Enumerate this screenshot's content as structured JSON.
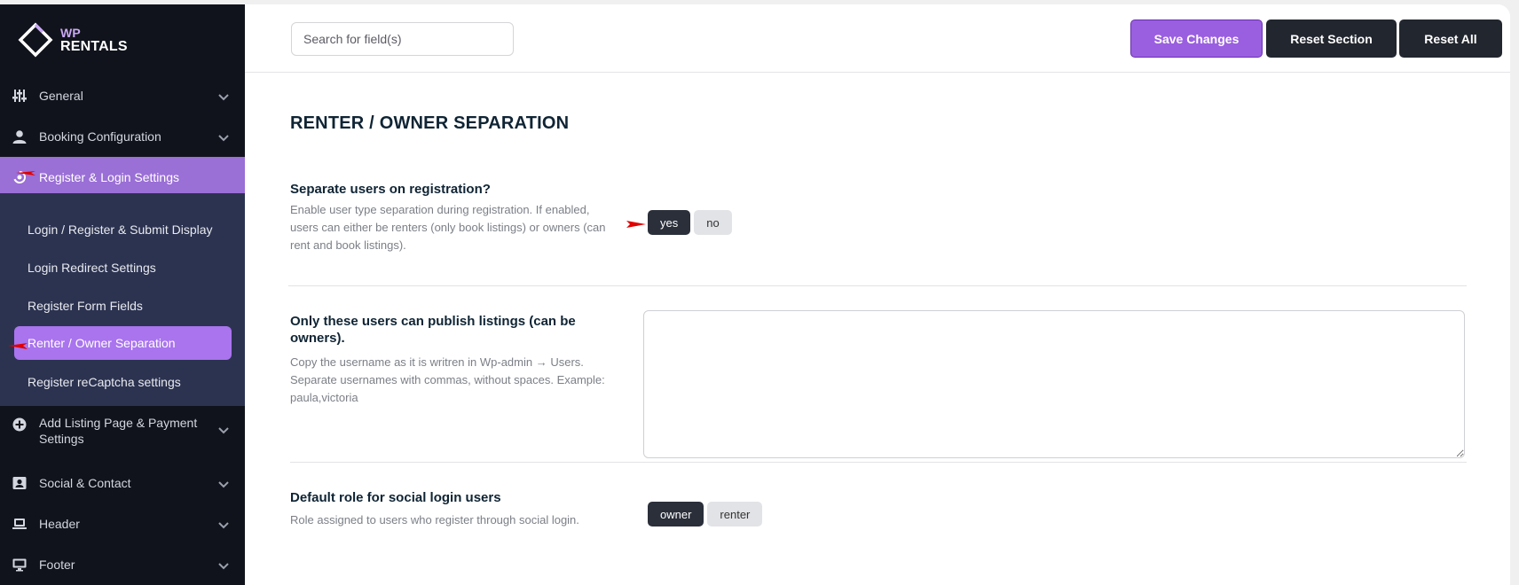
{
  "brand": {
    "line1": "WP",
    "line2": "RENTALS"
  },
  "sidebar": {
    "items": [
      {
        "label": "General",
        "icon": "sliders-icon"
      },
      {
        "label": "Booking Configuration",
        "icon": "user-icon"
      },
      {
        "label": "Register & Login Settings",
        "icon": "login-icon"
      },
      {
        "label": "Add Listing Page & Payment Settings",
        "icon": "plus-circle-icon"
      },
      {
        "label": "Social & Contact",
        "icon": "contact-card-icon"
      },
      {
        "label": "Header",
        "icon": "laptop-icon"
      },
      {
        "label": "Footer",
        "icon": "monitor-icon"
      }
    ],
    "submenu": [
      {
        "label": "Login / Register & Submit Display"
      },
      {
        "label": "Login Redirect Settings"
      },
      {
        "label": "Register Form Fields"
      },
      {
        "label": "Renter / Owner Separation"
      },
      {
        "label": "Register reCaptcha settings"
      }
    ]
  },
  "header": {
    "search_placeholder": "Search for field(s)",
    "save_label": "Save Changes",
    "reset_section_label": "Reset Section",
    "reset_all_label": "Reset All"
  },
  "main": {
    "section_title": "RENTER / OWNER SEPARATION",
    "fields": [
      {
        "title": "Separate users on registration?",
        "description": "Enable user type separation during registration. If enabled, users can either be renters (only book listings) or owners (can rent and book listings).",
        "options": [
          "yes",
          "no"
        ],
        "selected": "yes"
      },
      {
        "title": "Only these users can publish listings (can be owners).",
        "description": "Copy the username as it is writren in Wp-admin → Users. Separate usernames with commas, without spaces. Example: paula,victoria",
        "value": ""
      },
      {
        "title": "Default role for social login users",
        "description": "Role assigned to users who register through social login.",
        "options": [
          "owner",
          "renter"
        ],
        "selected": "owner"
      }
    ]
  },
  "colors": {
    "sidebar_bg": "#11131c",
    "active_item": "#9a6fd6",
    "submenu_bg": "#2c3350",
    "active_sub_item": "#a974ee",
    "save_button": "#9a5fe0",
    "dark_button": "#22262e",
    "pointer_arrow": "#e00000"
  }
}
